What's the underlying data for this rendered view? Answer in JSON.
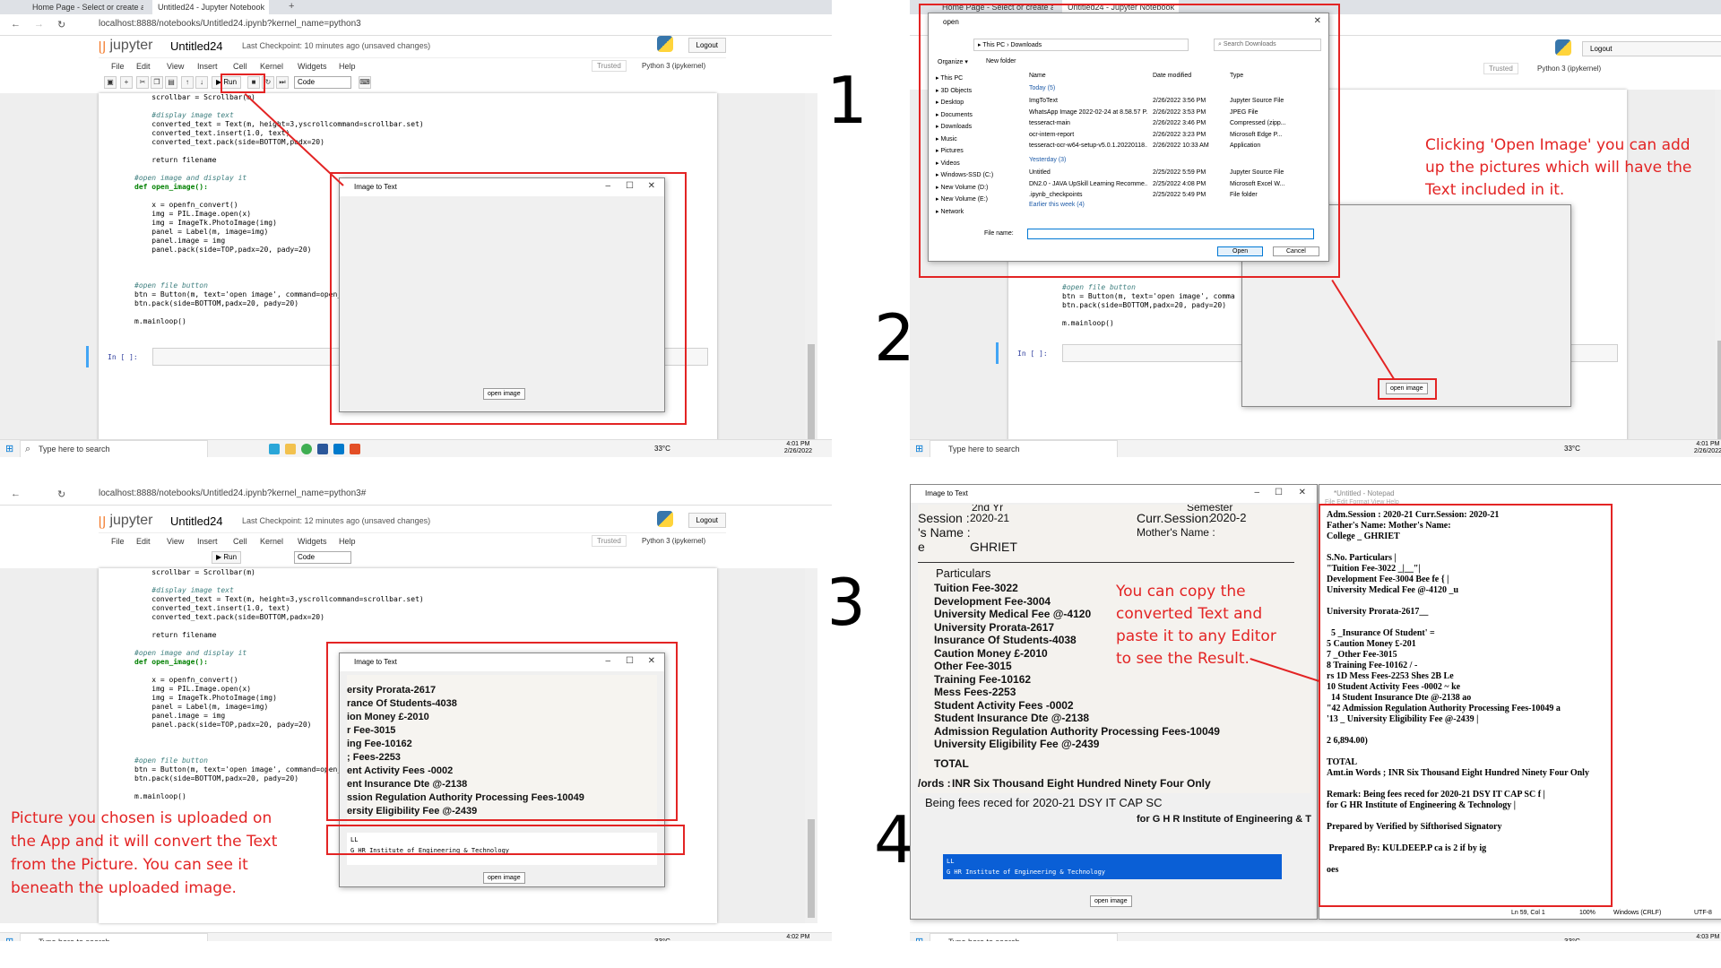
{
  "step_labels": [
    "1",
    "2",
    "3",
    "4"
  ],
  "browser": {
    "tab1": "Home Page - Select or create a n",
    "tab2": "Untitled24 - Jupyter Notebook",
    "url": "localhost:8888/notebooks/Untitled24.ipynb?kernel_name=python3",
    "url3": "localhost:8888/notebooks/Untitled24.ipynb?kernel_name=python3#"
  },
  "jupyter": {
    "logo": "jupyter",
    "notebook_name": "Untitled24",
    "checkpoint1": "Last Checkpoint: 10 minutes ago",
    "checkpoint3": "Last Checkpoint: 12 minutes ago",
    "unsaved": "(unsaved changes)",
    "logout": "Logout",
    "menu": [
      "File",
      "Edit",
      "View",
      "Insert",
      "Cell",
      "Kernel",
      "Widgets",
      "Help"
    ],
    "trusted": "Trusted",
    "kernel": "Python 3 (ipykernel)",
    "run": "Run",
    "cell_type": "Code",
    "in_prompt": "In [ ]:"
  },
  "code_lines": [
    {
      "t": "    scrollbar = Scrollbar(m)",
      "c": ""
    },
    {
      "t": "",
      "c": ""
    },
    {
      "t": "    #display image text",
      "c": "cmt"
    },
    {
      "t": "    converted_text = Text(m, height=3,yscrollcommand=scrollbar.set)",
      "c": ""
    },
    {
      "t": "    converted_text.insert(1.0, text)",
      "c": ""
    },
    {
      "t": "    converted_text.pack(side=BOTTOM,padx=20)",
      "c": ""
    },
    {
      "t": "",
      "c": ""
    },
    {
      "t": "    return filename",
      "c": ""
    },
    {
      "t": "",
      "c": ""
    },
    {
      "t": "#open image and display it",
      "c": "cmt"
    },
    {
      "t": "def open_image():",
      "c": "kw"
    },
    {
      "t": "",
      "c": ""
    },
    {
      "t": "    x = openfn_convert()",
      "c": ""
    },
    {
      "t": "    img = PIL.Image.open(x)",
      "c": ""
    },
    {
      "t": "    img = ImageTk.PhotoImage(img)",
      "c": ""
    },
    {
      "t": "    panel = Label(m, image=img)",
      "c": ""
    },
    {
      "t": "    panel.image = img",
      "c": ""
    },
    {
      "t": "    panel.pack(side=TOP,padx=20, pady=20)",
      "c": ""
    },
    {
      "t": "",
      "c": ""
    },
    {
      "t": "",
      "c": ""
    },
    {
      "t": "",
      "c": ""
    },
    {
      "t": "#open file button",
      "c": "cmt"
    },
    {
      "t": "btn = Button(m, text='open image', command=open_image)",
      "c": ""
    },
    {
      "t": "btn.pack(side=BOTTOM,padx=20, pady=20)",
      "c": ""
    },
    {
      "t": "",
      "c": ""
    },
    {
      "t": "m.mainloop()",
      "c": ""
    }
  ],
  "code2": [
    "#open file button",
    "btn = Button(m, text='open image', comma",
    "btn.pack(side=BOTTOM,padx=20, pady=20)",
    "",
    "m.mainloop()"
  ],
  "tk_window": {
    "title": "Image to Text",
    "button": "open image"
  },
  "taskbar": {
    "search": "Type here to search",
    "weather": "33°C",
    "lang": "ENG",
    "region": "IN",
    "time1": "4:01 PM",
    "time3": "4:02 PM",
    "time4": "4:03 PM",
    "date": "2/26/2022"
  },
  "open_dialog": {
    "title": "open",
    "path": [
      "This PC",
      "Downloads"
    ],
    "search": "Search Downloads",
    "organize": "Organize ▾",
    "new_folder": "New folder",
    "headers": [
      "Name",
      "Date modified",
      "Type"
    ],
    "nav": [
      "This PC",
      "3D Objects",
      "Desktop",
      "Documents",
      "Downloads",
      "Music",
      "Pictures",
      "Videos",
      "Windows-SSD (C:)",
      "New Volume (D:)",
      "New Volume (E:)",
      "Network"
    ],
    "group_today": "Today (5)",
    "group_yesterday": "Yesterday (3)",
    "files_today": [
      {
        "name": "ImgToText",
        "date": "2/26/2022 3:56 PM",
        "type": "Jupyter Source File"
      },
      {
        "name": "WhatsApp Image 2022-02-24 at 8.58.57 P...",
        "date": "2/26/2022 3:53 PM",
        "type": "JPEG File"
      },
      {
        "name": "tesseract-main",
        "date": "2/26/2022 3:46 PM",
        "type": "Compressed (zipp..."
      },
      {
        "name": "ocr-intern-report",
        "date": "2/26/2022 3:23 PM",
        "type": "Microsoft Edge P..."
      },
      {
        "name": "tesseract-ocr-w64-setup-v5.0.1.20220118....",
        "date": "2/26/2022 10:33 AM",
        "type": "Application"
      }
    ],
    "files_yesterday": [
      {
        "name": "Untitled",
        "date": "2/25/2022 5:59 PM",
        "type": "Jupyter Source File"
      },
      {
        "name": "DN2.0 - JAVA UpSkill Learning Recomme...",
        "date": "2/25/2022 4:08 PM",
        "type": "Microsoft Excel W..."
      },
      {
        "name": ".ipynb_checkpoints",
        "date": "2/25/2022 5:49 PM",
        "type": "File folder"
      }
    ],
    "partial_row": "Earlier this week (4)",
    "filename_label": "File name:",
    "open": "Open",
    "cancel": "Cancel"
  },
  "annotations": {
    "step2": "Clicking 'Open Image' you can add up the pictures which will have the Text included in it.",
    "step3": "Picture you chosen is uploaded on the App and it will convert the Text from the Picture. You can see it beneath the uploaded image.",
    "step4": "You can copy the converted Text and paste it to any Editor to see the Result."
  },
  "scan3": [
    "ersity Prorata-2617",
    "rance Of Students-4038",
    "ion Money £-2010",
    "r Fee-3015",
    "ing Fee-10162",
    "; Fees-2253",
    "ent Activity Fees -0002",
    "ent Insurance Dte @-2138",
    "ssion Regulation Authority Processing Fees-10049",
    "ersity Eligibility Fee @-2439"
  ],
  "output_text": [
    "LL",
    "G HR Institute of Engineering & Technology"
  ],
  "scan4": {
    "session": "Session :",
    "session_val": "2020-21",
    "name": "'s Name :",
    "college": "e",
    "college_val": "GHRIET",
    "curr": "Curr.Session:",
    "curr_val": "2020-2",
    "mother": "Mother's Name :",
    "top_partial": "2nd Yr",
    "top_partial2": "Semester",
    "particulars": "Particulars",
    "rows": [
      "Tuition Fee-3022",
      "Development Fee-3004",
      "University Medical Fee @-4120",
      "University Prorata-2617",
      "Insurance Of Students-4038",
      "Caution Money £-2010",
      "Other Fee-3015",
      "Training Fee-10162",
      "Mess Fees-2253",
      "Student Activity Fees -0002",
      "Student Insurance Dte @-2138",
      "Admission Regulation Authority Processing Fees-10049",
      "University Eligibility Fee @-2439"
    ],
    "total": "TOTAL",
    "words_label": "/ords :",
    "words": "INR Six Thousand Eight Hundred Ninety Four Only",
    "being": "Being fees reced for 2020-21 DSY IT CAP SC",
    "institute": "for G H R Institute of Engineering & T"
  },
  "notepad": {
    "title": "*Untitled - Notepad",
    "menu": "File  Edit  Format  View  Help",
    "lines": [
      "Adm.Session : 2020-21 Curr.Session: 2020-21",
      "Father's Name: Mother's Name:",
      "College _ GHRIET",
      "",
      "S.No. Particulars |",
      "\"Tuition Fee-3022 _|__\"|",
      "Development Fee-3004 Bee fe { |",
      "University Medical Fee @-4120 _u",
      "",
      "University Prorata-2617__",
      "",
      "  5 _Insurance Of Student' =",
      "5 Caution Money £-201",
      "7 _Other Fee-3015",
      "8 Training Fee-10162 / -",
      "rs 1D Mess Fees-2253 Shes 2B Le",
      "10 Student Activity Fees -0002 ~ ke",
      "  14 Student Insurance Dte @-2138 ao",
      "\"42 Admission Regulation Authority Processing Fees-10049 a",
      "'13 _ University Eligibility Fee @-2439 |",
      "",
      "2 6,894.00)",
      "",
      "TOTAL",
      "Amt.in Words ; INR Six Thousand Eight Hundred Ninety Four Only",
      "",
      "Remark: Being fees reced for 2020-21 DSY IT CAP SC f |",
      "for G HR Institute of Engineering & Technology |",
      "",
      "Prepared by Verified by Sifthorised Signatory",
      "",
      " Prepared By: KULDEEP.P ca is 2 if by ig",
      "",
      "oes"
    ],
    "status_pos": "Ln 59, Col 1",
    "status_zoom": "100%",
    "status_eol": "Windows (CRLF)",
    "status_enc": "UTF-8"
  },
  "colors": {
    "annotation": "#e32424",
    "jupyter_orange": "#f37726",
    "selected_blue": "#0a5fd6"
  }
}
